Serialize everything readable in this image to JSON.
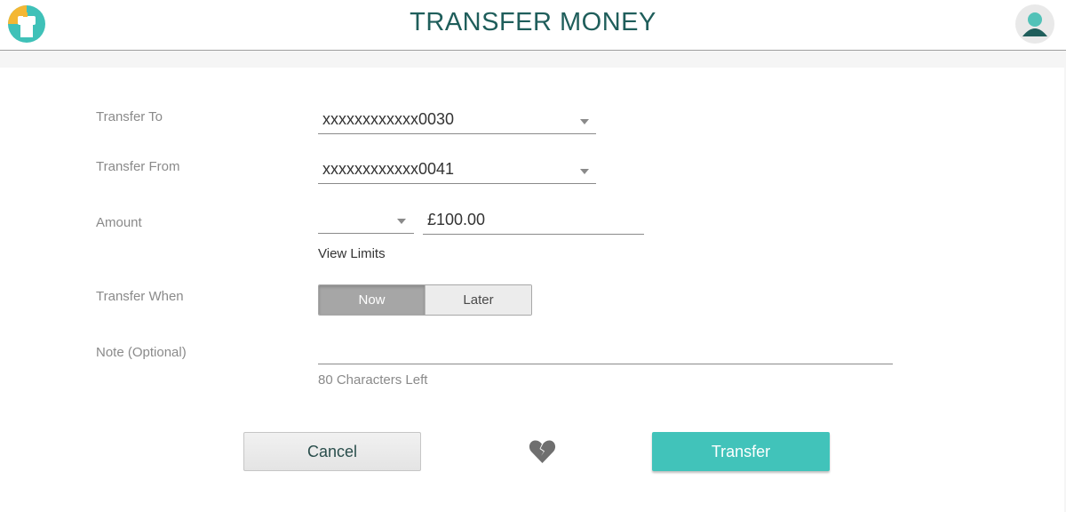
{
  "header": {
    "title": "TRANSFER MONEY",
    "logo_icon": "bank-logo-icon",
    "avatar_icon": "user-avatar-icon"
  },
  "form": {
    "transfer_to": {
      "label": "Transfer To",
      "value": "xxxxxxxxxxxx0030"
    },
    "transfer_from": {
      "label": "Transfer From",
      "value": "xxxxxxxxxxxx0041"
    },
    "amount": {
      "label": "Amount",
      "currency_value": "",
      "value": "£100.00"
    },
    "view_limits": "View Limits",
    "transfer_when": {
      "label": "Transfer When",
      "options": [
        "Now",
        "Later"
      ],
      "selected": "Now"
    },
    "note": {
      "label": "Note (Optional)",
      "value": "",
      "counter": "80 Characters Left"
    }
  },
  "actions": {
    "cancel": "Cancel",
    "transfer": "Transfer",
    "center_icon": "broken-heart-icon"
  },
  "colors": {
    "accent": "#41c3ba",
    "title": "#1f5e5b",
    "segment_selected": "#a6a6a6"
  }
}
